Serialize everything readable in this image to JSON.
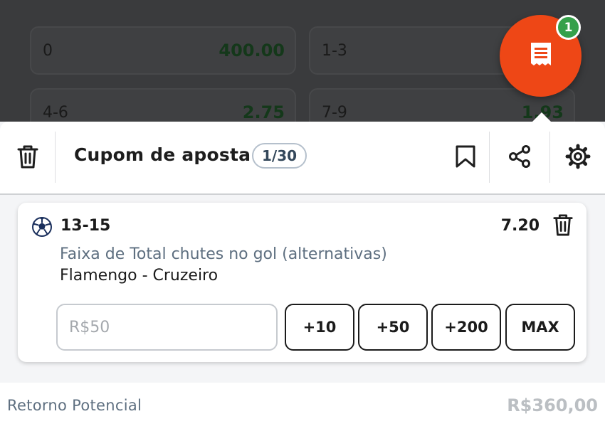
{
  "odds_grid": [
    {
      "label": "0",
      "value": "400.00"
    },
    {
      "label": "1-3",
      "value": ""
    },
    {
      "label": "4-6",
      "value": "2.75"
    },
    {
      "label": "7-9",
      "value": "1.93"
    }
  ],
  "fab": {
    "icon": "receipt-icon",
    "badge": "1",
    "color": "#ee4716",
    "badge_color": "#35a04a"
  },
  "header": {
    "title": "Cupom de aposta",
    "counter": "1/30",
    "icons": [
      "trash-icon",
      "bookmark-icon",
      "share-icon",
      "settings-icon"
    ]
  },
  "bet": {
    "sport_icon": "soccer-ball-icon",
    "selection": "13-15",
    "odd": "7.20",
    "market": "Faixa de Total chutes no gol (alternativas)",
    "event": "Flamengo - Cruzeiro",
    "stake_placeholder": "R$50",
    "quick_stakes": [
      "+10",
      "+50",
      "+200",
      "MAX"
    ]
  },
  "footer": {
    "potential_return_label": "Retorno Potencial",
    "potential_return_value": "R$360,00"
  }
}
